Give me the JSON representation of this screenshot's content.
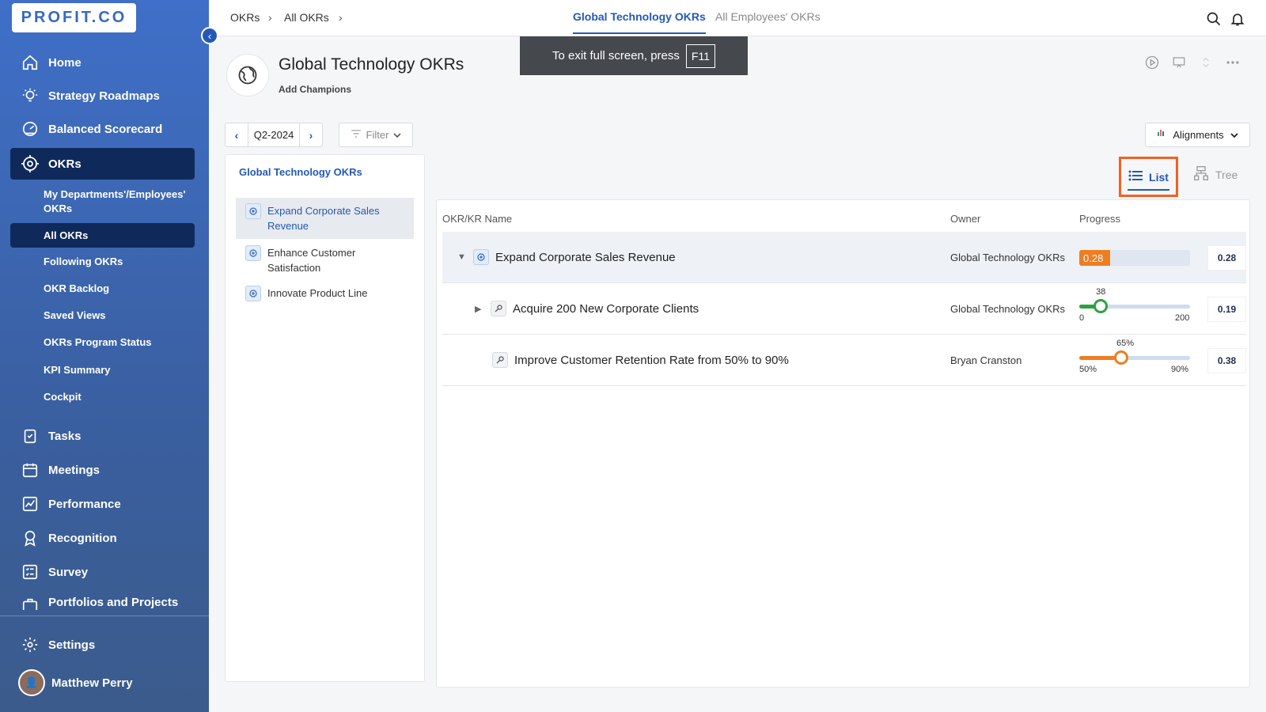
{
  "app": {
    "logo": "PROFIT.CO"
  },
  "sidebar": {
    "items": [
      {
        "label": "Home"
      },
      {
        "label": "Strategy Roadmaps"
      },
      {
        "label": "Balanced Scorecard"
      },
      {
        "label": "OKRs"
      }
    ],
    "sub_items": [
      {
        "label": "My Departments'/Employees' OKRs"
      },
      {
        "label": "All OKRs"
      },
      {
        "label": "Following OKRs"
      },
      {
        "label": "OKR Backlog"
      },
      {
        "label": "Saved Views"
      },
      {
        "label": "OKRs Program Status"
      },
      {
        "label": "KPI Summary"
      },
      {
        "label": "Cockpit"
      }
    ],
    "items2": [
      {
        "label": "Tasks"
      },
      {
        "label": "Meetings"
      },
      {
        "label": "Performance"
      },
      {
        "label": "Recognition"
      },
      {
        "label": "Survey"
      },
      {
        "label": "Portfolios and Projects"
      }
    ],
    "settings": "Settings",
    "user": "Matthew Perry"
  },
  "topbar": {
    "crumbs": [
      "OKRs",
      "All OKRs"
    ],
    "tab_active": "Global Technology OKRs",
    "tab_other": "All Employees' OKRs"
  },
  "header": {
    "title": "Global Technology OKRs",
    "add_champions": "Add Champions",
    "toast": "To exit full screen, press",
    "toast_key": "F11"
  },
  "controls": {
    "period": "Q2-2024",
    "filter": "Filter",
    "alignments": "Alignments",
    "view_list": "List",
    "view_tree": "Tree"
  },
  "left_panel": {
    "title": "Global Technology OKRs",
    "items": [
      {
        "label": "Expand Corporate Sales Revenue"
      },
      {
        "label": "Enhance Customer Satisfaction"
      },
      {
        "label": "Innovate Product Line"
      }
    ]
  },
  "table": {
    "headers": [
      "OKR/KR Name",
      "Owner",
      "Progress"
    ],
    "rows": [
      {
        "name": "Expand Corporate Sales Revenue",
        "owner": "Global Technology OKRs",
        "progress_label": "0.28",
        "progress": 0.28,
        "score": "0.28"
      },
      {
        "name": "Acquire 200 New Corporate Clients",
        "owner": "Global Technology OKRs",
        "current": "38",
        "min": "0",
        "max": "200",
        "progress": 0.19,
        "score": "0.19"
      },
      {
        "name": "Improve Customer Retention Rate from 50% to 90%",
        "owner": "Bryan Cranston",
        "current": "65%",
        "min": "50%",
        "max": "90%",
        "progress": 0.375,
        "score": "0.38"
      }
    ]
  },
  "colors": {
    "accent": "#2458b8",
    "highlight": "#f26122",
    "progress_orange": "#ef7d22",
    "progress_green": "#2ea043"
  }
}
